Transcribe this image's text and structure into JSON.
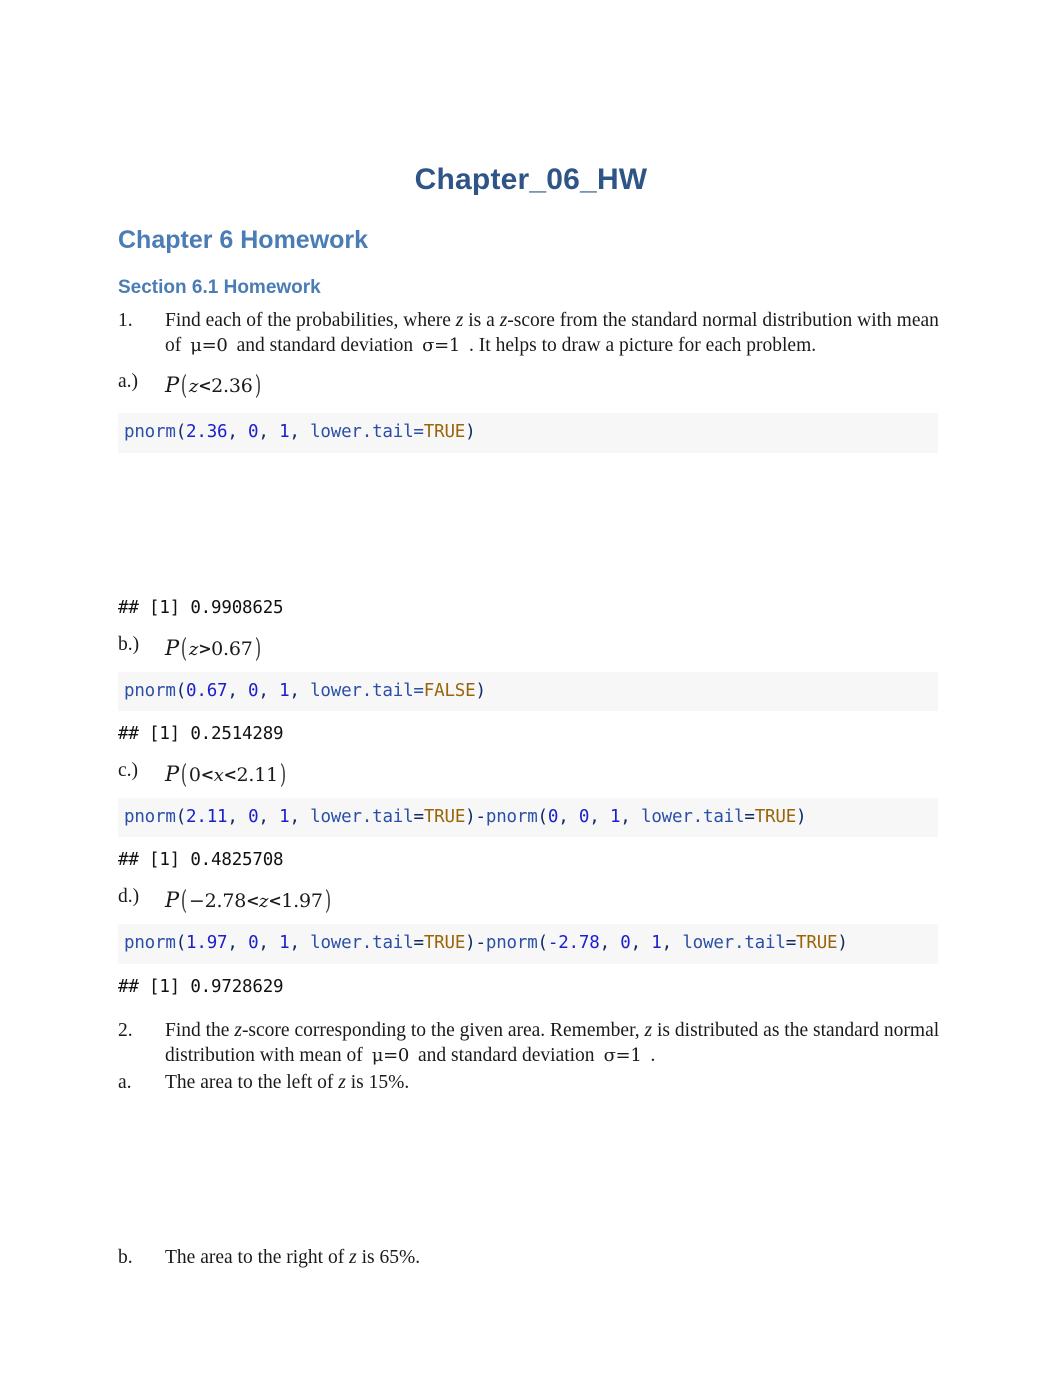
{
  "document": {
    "title": "Chapter_06_HW",
    "heading2": "Chapter 6 Homework",
    "heading3": "Section 6.1 Homework"
  },
  "q1": {
    "marker": "1.",
    "text_part1": "Find each of the probabilities, where ",
    "text_z1": "z",
    "text_part2": " is a ",
    "text_z2": "z",
    "text_part3": "-score from the standard normal distribution with mean of",
    "math_mu": "μ=0",
    "text_part4": "and standard deviation",
    "math_sigma": "σ=1",
    "text_part5": ". It helps to draw a picture for each problem."
  },
  "parts": [
    {
      "marker": "a.)",
      "prob": {
        "p": "P",
        "open": "(",
        "left": "z",
        "rel": "<",
        "right": "2.36",
        "close": ")"
      },
      "code": {
        "fn": "pnorm",
        "open": "(",
        "args": [
          "2.36",
          "0",
          "1"
        ],
        "param": "lower.tail=",
        "bool": "TRUE",
        "close": ")",
        "full": "pnorm(2.36, 0, 1, lower.tail=TRUE)"
      },
      "output": "## [1] 0.9908625",
      "has_plot_gap": true
    },
    {
      "marker": "b.)",
      "prob": {
        "p": "P",
        "open": "(",
        "left": "z",
        "rel": ">",
        "right": "0.67",
        "close": ")"
      },
      "code": {
        "fn": "pnorm",
        "open": "(",
        "args": [
          "0.67",
          "0",
          "1"
        ],
        "param": "lower.tail=",
        "bool": "FALSE",
        "close": ")",
        "full": "pnorm(0.67, 0, 1, lower.tail=FALSE)"
      },
      "output": "## [1] 0.2514289",
      "has_plot_gap": false
    },
    {
      "marker": "c.)",
      "prob": {
        "p": "P",
        "open": "(",
        "left": "0",
        "rel": "<",
        "mid": "x",
        "rel2": "<",
        "right": "2.11",
        "close": ")"
      },
      "code": {
        "full": "pnorm(2.11, 0, 1, lower.tail=TRUE)-pnorm(0, 0, 1, lower.tail=TRUE)"
      },
      "output": "## [1] 0.4825708",
      "has_plot_gap": false
    },
    {
      "marker": "d.)",
      "prob": {
        "p": "P",
        "open": "(",
        "left": "−2.78",
        "rel": "<",
        "mid": "z",
        "rel2": "<",
        "right": "1.97",
        "close": ")"
      },
      "code": {
        "full": "pnorm(1.97, 0, 1, lower.tail=TRUE)-pnorm(-2.78, 0, 1, lower.tail=TRUE)"
      },
      "output": "## [1] 0.9728629",
      "has_plot_gap": false
    }
  ],
  "q2": {
    "marker": "2.",
    "text_part1": "Find the ",
    "text_z1": "z",
    "text_part2": "-score corresponding to the given area. Remember, ",
    "text_z2": "z",
    "text_part3": " is distributed as the standard normal distribution with mean of",
    "math_mu": "μ=0",
    "text_part4": "and standard deviation",
    "math_sigma": "σ=1",
    "text_part5": ".",
    "items": [
      {
        "marker": "a.",
        "text_pre": "The area to the left of ",
        "text_var": "z",
        "text_post": " is 15%."
      },
      {
        "marker": "b.",
        "text_pre": "The area to the right of ",
        "text_var": "z",
        "text_post": " is 65%."
      }
    ]
  },
  "colors": {
    "title": "#2e5585",
    "heading": "#4a7cb5",
    "code_bg": "#f7f7f7",
    "code_fn": "#2a4fa8",
    "code_num": "#1c20cc",
    "code_bool": "#9a6508",
    "body_text": "#1a1a1a"
  }
}
